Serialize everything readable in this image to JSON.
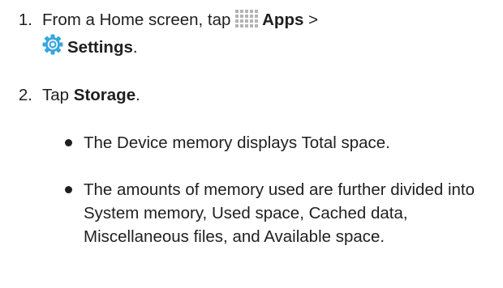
{
  "steps": [
    {
      "number": "1.",
      "prefix": "From a Home screen, tap",
      "apps_icon": "apps-grid-icon",
      "apps_label": "Apps",
      "separator": ">",
      "settings_icon": "settings-gear-icon",
      "settings_label": "Settings",
      "suffix": "."
    },
    {
      "number": "2.",
      "prefix": "Tap",
      "target_label": "Storage",
      "suffix": "."
    }
  ],
  "bullets": [
    "The Device memory displays Total space.",
    "The amounts of memory used are further divided into System memory, Used space, Cached data, Miscellaneous files, and Available space."
  ],
  "colors": {
    "text": "#1f1f1f",
    "apps_icon": "#b3b3b3",
    "settings_icon_outer": "#37a6e0",
    "settings_icon_inner": "#ffffff"
  }
}
